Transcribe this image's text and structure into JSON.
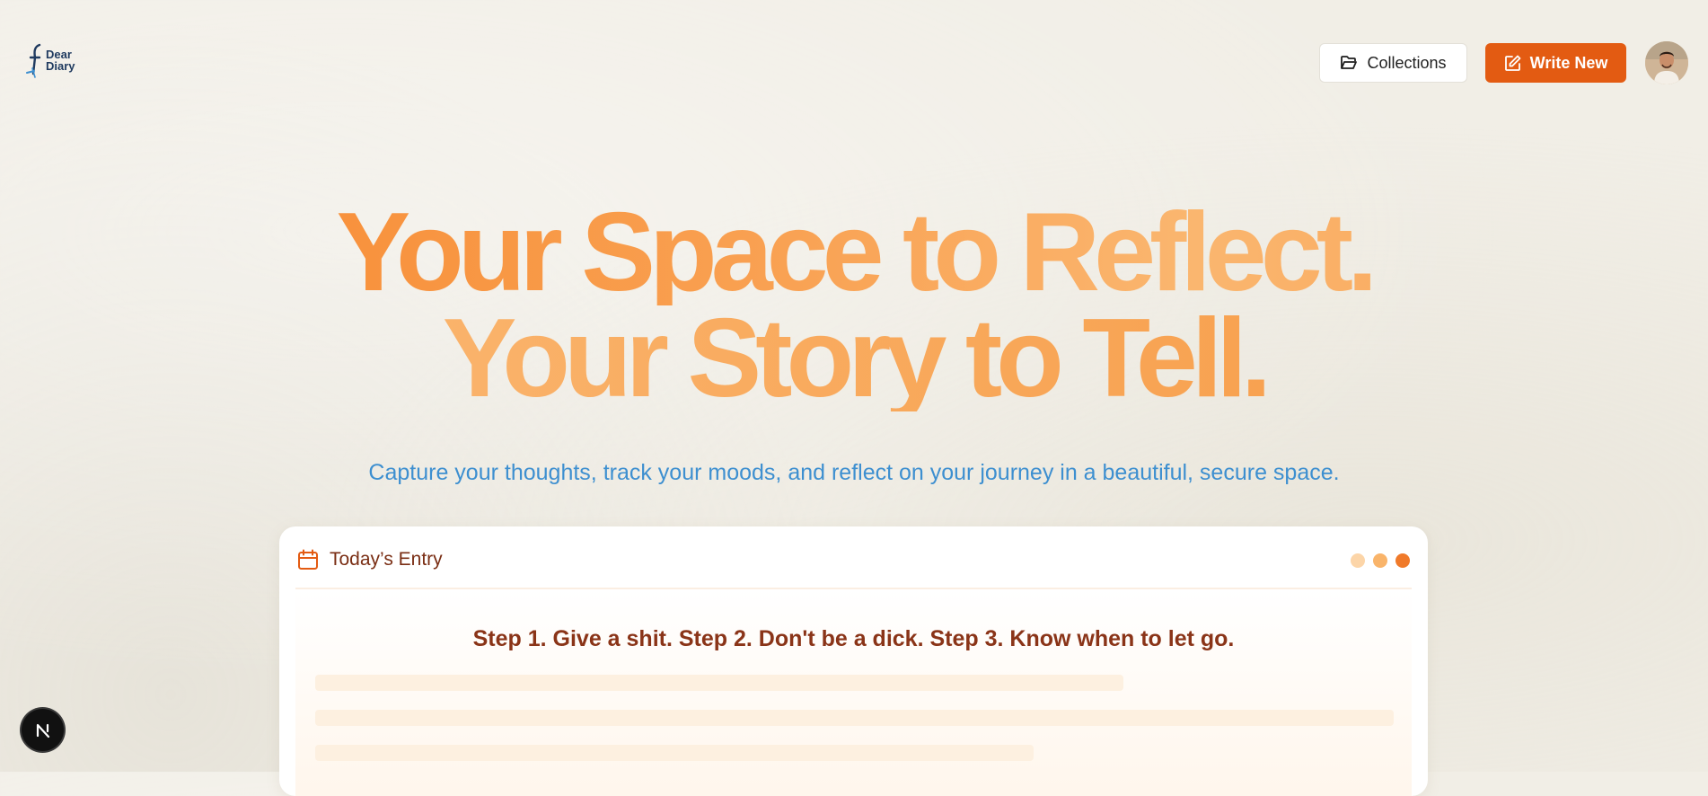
{
  "header": {
    "logo": {
      "line1": "Dear",
      "line2": "Diary",
      "icon": "fountain-pen-icon"
    },
    "collections_label": "Collections",
    "collections_icon": "folder-open-icon",
    "write_new_label": "Write New",
    "write_new_icon": "edit-square-icon",
    "avatar_icon": "user-avatar-icon"
  },
  "hero": {
    "title_line1": "Your Space to Reflect.",
    "title_line2": "Your Story to Tell.",
    "subtitle": "Capture your thoughts, track your moods, and reflect on your journey in a beautiful, secure space."
  },
  "entry_card": {
    "title": "Today’s Entry",
    "icon": "calendar-icon",
    "quote": "Step 1. Give a shit. Step 2. Don't be a dick. Step 3. Know when to let go.",
    "window_dots": [
      "#fcd5a8",
      "#f9b46a",
      "#f07a2a"
    ]
  },
  "colors": {
    "accent": "#e35b12",
    "hero_gradient_start": "#f7862c",
    "hero_gradient_end": "#fab66f",
    "subtitle": "#3d8fd0",
    "card_text": "#7a2e14"
  },
  "floating_badge": {
    "icon": "nextjs-logo-icon"
  }
}
